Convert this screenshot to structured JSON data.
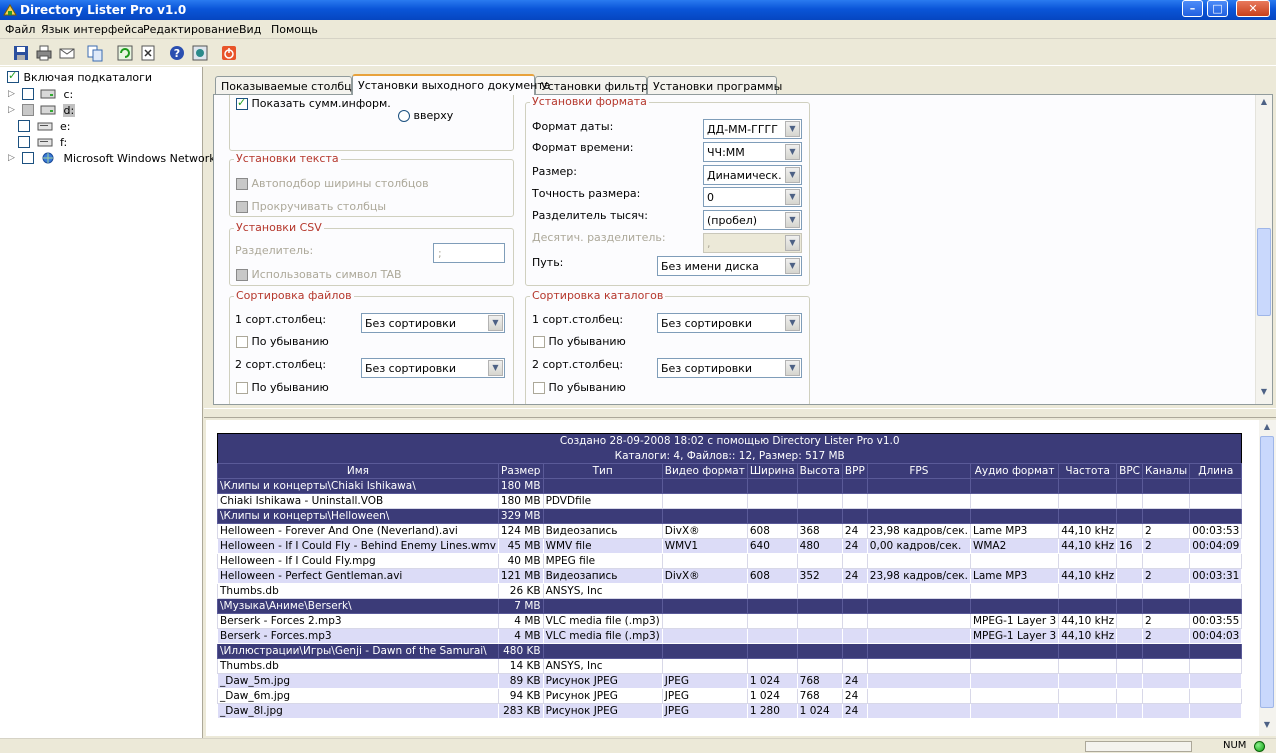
{
  "window": {
    "title": "Directory Lister Pro v1.0"
  },
  "menu": [
    "Файл",
    "Язык интерфейса",
    "Редактирование",
    "Вид",
    "Помощь"
  ],
  "toolbar": [
    "save-icon",
    "print-icon",
    "email-icon",
    "copy-icon",
    "refresh-icon",
    "clear-icon",
    "help-icon",
    "about-icon",
    "exit-icon"
  ],
  "tree": {
    "include_subdirs": "Включая подкаталоги",
    "items": [
      {
        "label": "c:",
        "checked": false,
        "icon": "drive-icon"
      },
      {
        "label": "d:",
        "checked": "partial",
        "icon": "drive-icon"
      },
      {
        "label": "e:",
        "checked": false,
        "icon": "cd-drive-icon"
      },
      {
        "label": "f:",
        "checked": false,
        "icon": "cd-drive-icon"
      },
      {
        "label": "Microsoft Windows Network",
        "checked": false,
        "icon": "network-icon"
      }
    ]
  },
  "tabs": [
    "Показываемые столбцы",
    "Установки выходного документа",
    "Установки фильтра",
    "Установки программы"
  ],
  "settings": {
    "show_summary": "Показать сумм.информ.",
    "top_radio": "вверху",
    "text_group": "Установки текста",
    "autofit": "Автоподбор ширины столбцов",
    "scroll_cols": "Прокручивать столбцы",
    "csv_group": "Установки CSV",
    "separator_label": "Разделитель:",
    "separator_value": ";",
    "use_tab": "Использовать символ TAB",
    "format_group": "Установки формата",
    "date_fmt_label": "Формат даты:",
    "date_fmt_value": "ДД-ММ-ГГГГ",
    "time_fmt_label": "Формат времени:",
    "time_fmt_value": "ЧЧ:ММ",
    "size_label": "Размер:",
    "size_value": "Динамическ.",
    "size_prec_label": "Точность размера:",
    "size_prec_value": "0",
    "thousand_label": "Разделитель тысяч:",
    "thousand_value": "(пробел)",
    "decimal_label": "Десятич. разделитель:",
    "decimal_value": ",",
    "path_label": "Путь:",
    "path_value": "Без имени диска",
    "file_sort_group": "Сортировка файлов",
    "dir_sort_group": "Сортировка каталогов",
    "sort1_label": "1 сорт.столбец:",
    "sort2_label": "2 сорт.столбец:",
    "sort_none": "Без сортировки",
    "desc_label": "По убыванию"
  },
  "report": {
    "title": "Создано 28-09-2008 18:02 с помощью Directory Lister Pro v1.0",
    "summary": "Каталоги: 4, Файлов:: 12, Размер: 517 MB",
    "columns": [
      "Имя",
      "Размер",
      "Тип",
      "Видео формат",
      "Ширина",
      "Высота",
      "BPP",
      "FPS",
      "Аудио формат",
      "Частота",
      "BPC",
      "Каналы",
      "Длина"
    ],
    "rows": [
      {
        "dir": true,
        "c": [
          "\\Клипы и концерты\\Chiaki Ishikawa\\",
          "180 MB"
        ]
      },
      {
        "c": [
          "Chiaki Ishikawa - Uninstall.VOB",
          "180 MB",
          "PDVDfile",
          "",
          "",
          "",
          "",
          "",
          "",
          "",
          "",
          "",
          ""
        ]
      },
      {
        "dir": true,
        "c": [
          "\\Клипы и концерты\\Helloween\\",
          "329 MB"
        ]
      },
      {
        "c": [
          "Helloween - Forever And One (Neverland).avi",
          "124 MB",
          "Видеозапись",
          "DivX®",
          "608",
          "368",
          "24",
          "23,98 кадров/сек.",
          "Lame MP3",
          "44,10 kHz",
          "",
          "2",
          "00:03:53"
        ]
      },
      {
        "c": [
          "Helloween - If I Could Fly - Behind Enemy Lines.wmv",
          "45 MB",
          "WMV file",
          "WMV1",
          "640",
          "480",
          "24",
          "0,00 кадров/сек.",
          "WMA2",
          "44,10 kHz",
          "16",
          "2",
          "00:04:09"
        ]
      },
      {
        "c": [
          "Helloween - If I Could Fly.mpg",
          "40 MB",
          "MPEG file",
          "",
          "",
          "",
          "",
          "",
          "",
          "",
          "",
          "",
          ""
        ]
      },
      {
        "c": [
          "Helloween - Perfect Gentleman.avi",
          "121 MB",
          "Видеозапись",
          "DivX®",
          "608",
          "352",
          "24",
          "23,98 кадров/сек.",
          "Lame MP3",
          "44,10 kHz",
          "",
          "2",
          "00:03:31"
        ]
      },
      {
        "c": [
          "Thumbs.db",
          "26 KB",
          "ANSYS, Inc",
          "",
          "",
          "",
          "",
          "",
          "",
          "",
          "",
          "",
          ""
        ]
      },
      {
        "dir": true,
        "c": [
          "\\Музыка\\Аниме\\Berserk\\",
          "7 MB"
        ]
      },
      {
        "c": [
          "Berserk - Forces 2.mp3",
          "4 MB",
          "VLC media file (.mp3)",
          "",
          "",
          "",
          "",
          "",
          "MPEG-1 Layer 3",
          "44,10 kHz",
          "",
          "2",
          "00:03:55"
        ]
      },
      {
        "c": [
          "Berserk - Forces.mp3",
          "4 MB",
          "VLC media file (.mp3)",
          "",
          "",
          "",
          "",
          "",
          "MPEG-1 Layer 3",
          "44,10 kHz",
          "",
          "2",
          "00:04:03"
        ]
      },
      {
        "dir": true,
        "c": [
          "\\Иллюстрации\\Игры\\Genji - Dawn of the Samurai\\",
          "480 KB"
        ]
      },
      {
        "c": [
          "Thumbs.db",
          "14 KB",
          "ANSYS, Inc",
          "",
          "",
          "",
          "",
          "",
          "",
          "",
          "",
          "",
          ""
        ]
      },
      {
        "c": [
          "_Daw_5m.jpg",
          "89 KB",
          "Рисунок JPEG",
          "JPEG",
          "1 024",
          "768",
          "24",
          "",
          "",
          "",
          "",
          "",
          ""
        ]
      },
      {
        "c": [
          "_Daw_6m.jpg",
          "94 KB",
          "Рисунок JPEG",
          "JPEG",
          "1 024",
          "768",
          "24",
          "",
          "",
          "",
          "",
          "",
          ""
        ]
      },
      {
        "c": [
          "_Daw_8l.jpg",
          "283 KB",
          "Рисунок JPEG",
          "JPEG",
          "1 280",
          "1 024",
          "24",
          "",
          "",
          "",
          "",
          "",
          ""
        ]
      }
    ]
  },
  "status": {
    "num": "NUM"
  }
}
